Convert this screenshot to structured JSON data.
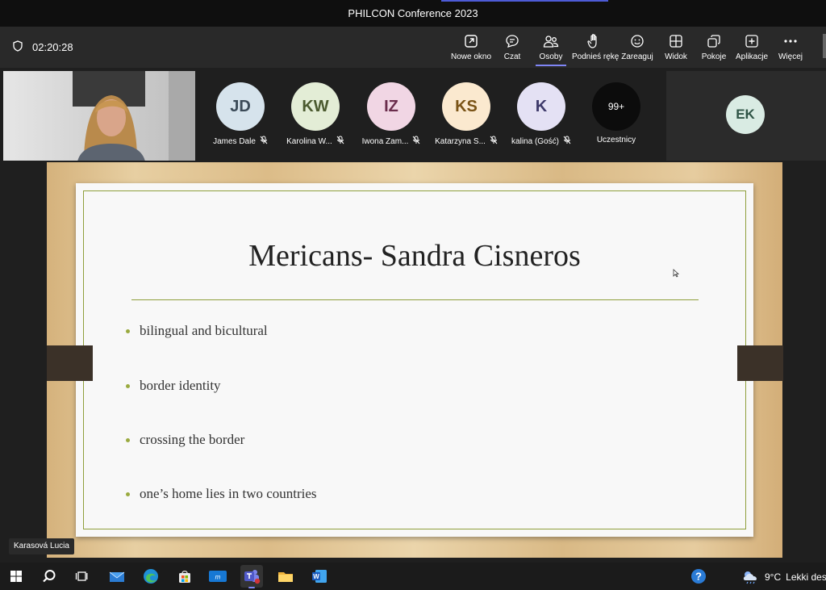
{
  "window": {
    "title": "PHILCON Conference 2023"
  },
  "meeting": {
    "timer": "02:20:28"
  },
  "toolbar": {
    "buttons": [
      {
        "label": "Nowe okno",
        "icon": "pop-out-icon"
      },
      {
        "label": "Czat",
        "icon": "chat-icon"
      },
      {
        "label": "Osoby",
        "icon": "people-icon"
      },
      {
        "label": "Podnieś rękę",
        "icon": "raise-hand-icon"
      },
      {
        "label": "Zareaguj",
        "icon": "react-icon"
      },
      {
        "label": "Widok",
        "icon": "view-icon"
      },
      {
        "label": "Pokoje",
        "icon": "rooms-icon"
      },
      {
        "label": "Aplikacje",
        "icon": "apps-icon"
      },
      {
        "label": "Więcej",
        "icon": "more-icon"
      }
    ]
  },
  "participants": [
    {
      "initials": "JD",
      "name": "James Dale",
      "bg": "#d6e3ec",
      "fg": "#3b4a57"
    },
    {
      "initials": "KW",
      "name": "Karolina W...",
      "bg": "#e3edd6",
      "fg": "#4b5a2f"
    },
    {
      "initials": "IZ",
      "name": "Iwona Zam...",
      "bg": "#f1d6e4",
      "fg": "#6a2d4c"
    },
    {
      "initials": "KS",
      "name": "Katarzyna S...",
      "bg": "#fbe9cf",
      "fg": "#7a5316"
    },
    {
      "initials": "K",
      "name": "kalina (Gość)",
      "bg": "#e4e1f4",
      "fg": "#3e3a6a"
    }
  ],
  "attendees": {
    "count": "99+",
    "label": "Uczestnicy"
  },
  "side_participant": {
    "initials": "EK",
    "bg": "#d9ebe3",
    "fg": "#2f5446"
  },
  "slide": {
    "title": "Mericans- Sandra Cisneros",
    "bullets": [
      "bilingual and bicultural",
      "border identity",
      "crossing the border",
      "one’s home lies in two countries"
    ]
  },
  "presenter": {
    "name": "Karasová Lucia"
  },
  "taskbar": {
    "weather_temp": "9°C",
    "weather_text": "Lekki desz"
  },
  "colors": {
    "accent": "#7f85f5",
    "slide_line": "#8f9f3c"
  }
}
